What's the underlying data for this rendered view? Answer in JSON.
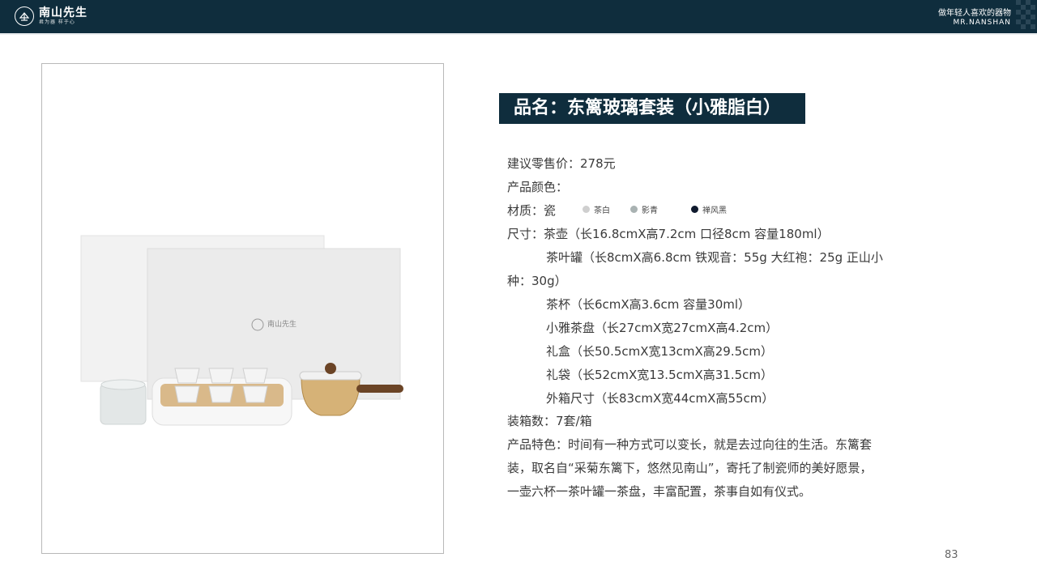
{
  "header": {
    "logo_name": "南山先生",
    "logo_tagline": "君为器 样于心",
    "slogan_cn": "做年轻人喜欢的器物",
    "slogan_en": "MR.NANSHAN"
  },
  "product": {
    "title": "品名：东篱玻璃套装（小雅脂白）",
    "box_logo": "南山先生",
    "lines": {
      "price": "建议零售价：278元",
      "color": "产品颜色：",
      "material": "材质：瓷",
      "size1": "尺寸：茶壶（长16.8cmX高7.2cm  口径8cm 容量180ml）",
      "size2": "茶叶罐（长8cmX高6.8cm  铁观音：55g 大红袍：25g 正山小",
      "size2b": "种：30g）",
      "size3": "茶杯（长6cmX高3.6cm  容量30ml）",
      "size4": "小雅茶盘（长27cmX宽27cmX高4.2cm）",
      "size5": "礼盒（长50.5cmX宽13cmX高29.5cm）",
      "size6": "礼袋（长52cmX宽13.5cmX高31.5cm）",
      "size7": "外箱尺寸（长83cmX宽44cmX高55cm）",
      "count": "装箱数：7套/箱",
      "feat1": "产品特色：时间有一种方式可以变长，就是去过向往的生活。东篱套",
      "feat2": "装，取名自“采菊东篱下，悠然见南山”，寄托了制瓷师的美好愿景，",
      "feat3": "一壶六杯一茶叶罐一茶盘，丰富配置，茶事自如有仪式。"
    },
    "swatches": [
      {
        "label": "茶白",
        "color": "#cfcfcf"
      },
      {
        "label": "影青",
        "color": "#a9b2b2"
      },
      {
        "label": "禅风黑",
        "color": "#0f1a2e"
      }
    ]
  },
  "page_number": "83",
  "colors": {
    "navy": "#0f2d3d"
  }
}
